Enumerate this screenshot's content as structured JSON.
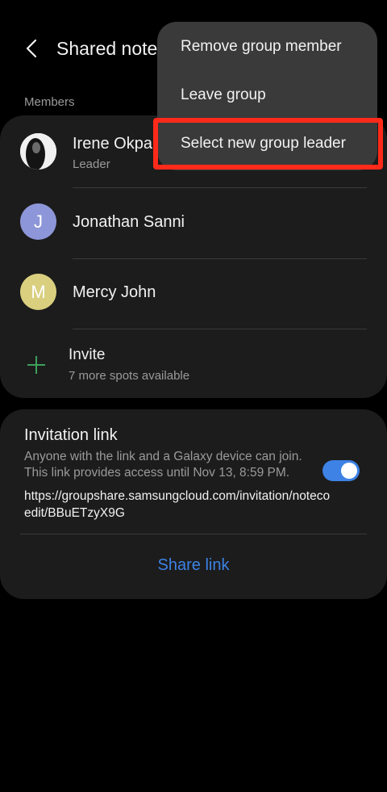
{
  "header": {
    "title": "Shared note"
  },
  "members_section": {
    "label": "Members"
  },
  "members": [
    {
      "name": "Irene Okpa",
      "role": "Leader",
      "initial": "",
      "avatar_color": "#111111"
    },
    {
      "name": "Jonathan Sanni",
      "role": "",
      "initial": "J",
      "avatar_color": "#8d96d8"
    },
    {
      "name": "Mercy John",
      "role": "",
      "initial": "M",
      "avatar_color": "#d9cf7f"
    }
  ],
  "invite": {
    "label": "Invite",
    "sub": "7 more spots available",
    "icon": "plus-icon",
    "icon_color": "#3ca05a"
  },
  "invitation": {
    "title": "Invitation link",
    "description": "Anyone with the link and a Galaxy device can join. This link provides access until Nov 13, 8:59 PM.",
    "enabled": true,
    "url": "https://groupshare.samsungcloud.com/invitation/notecoedit/BBuETzyX9G",
    "share_label": "Share link",
    "accent": "#3d82e4"
  },
  "menu": {
    "items": [
      {
        "label": "Remove group member"
      },
      {
        "label": "Leave group"
      },
      {
        "label": "Select new group leader"
      }
    ],
    "highlight_color": "#ff2a1a"
  }
}
